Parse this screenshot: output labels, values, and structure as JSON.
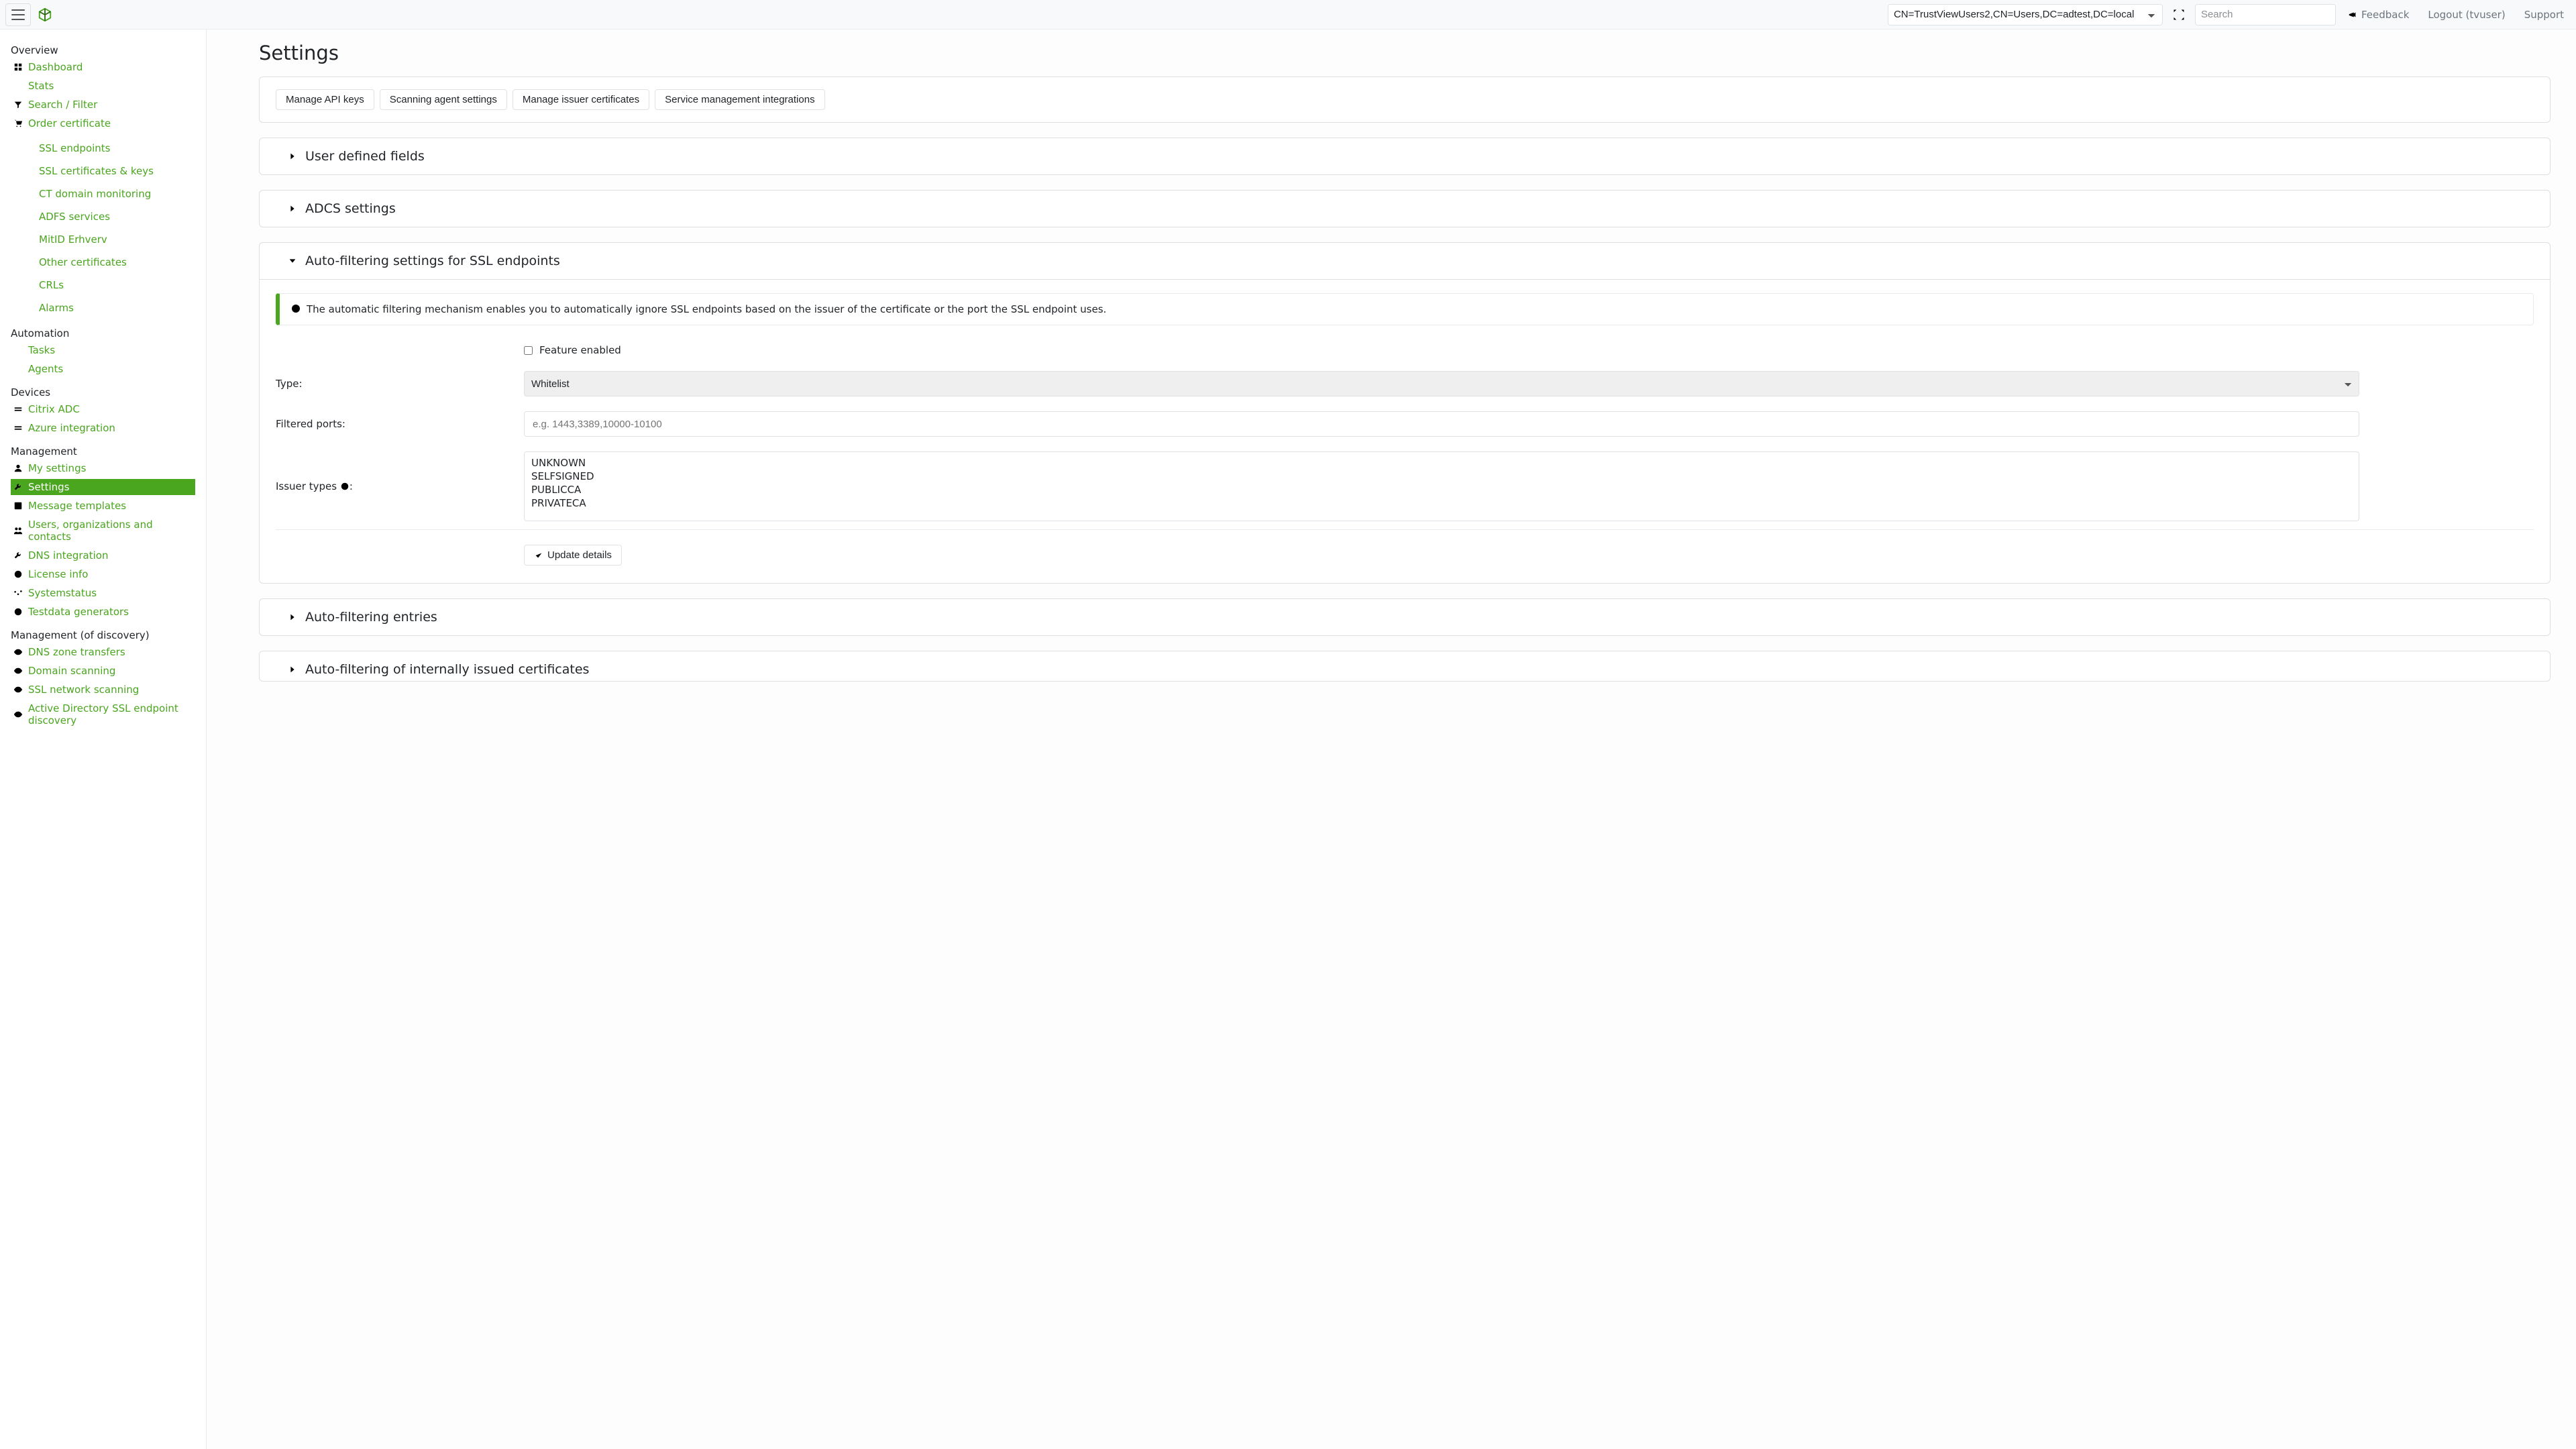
{
  "header": {
    "org_selected": "CN=TrustViewUsers2,CN=Users,DC=adtest,DC=local",
    "search_placeholder": "Search",
    "feedback": "Feedback",
    "logout": "Logout (tvuser)",
    "support": "Support"
  },
  "sidebar": {
    "groups": [
      {
        "title": "Overview",
        "items": [
          {
            "label": "Dashboard",
            "icon": "dashboard-icon"
          },
          {
            "label": "Stats",
            "icon": "list-icon"
          },
          {
            "label": "Search / Filter",
            "icon": "filter-icon"
          },
          {
            "label": "Order certificate",
            "icon": "cart-icon"
          }
        ],
        "secondary": [
          {
            "label": "SSL endpoints",
            "icon": "list-icon"
          },
          {
            "label": "SSL certificates & keys",
            "icon": "list-icon"
          },
          {
            "label": "CT domain monitoring",
            "icon": "list-icon"
          },
          {
            "label": "ADFS services",
            "icon": "list-icon"
          },
          {
            "label": "MitID Erhverv",
            "icon": "list-icon"
          },
          {
            "label": "Other certificates",
            "icon": "list-icon"
          },
          {
            "label": "CRLs",
            "icon": "list-icon"
          },
          {
            "label": "Alarms",
            "icon": "list-icon"
          }
        ]
      },
      {
        "title": "Automation",
        "items": [
          {
            "label": "Tasks",
            "icon": "list-icon"
          },
          {
            "label": "Agents",
            "icon": "list-icon"
          }
        ]
      },
      {
        "title": "Devices",
        "items": [
          {
            "label": "Citrix ADC",
            "icon": "stack-icon"
          },
          {
            "label": "Azure integration",
            "icon": "stack-icon"
          }
        ]
      },
      {
        "title": "Management",
        "items": [
          {
            "label": "My settings",
            "icon": "user-icon"
          },
          {
            "label": "Settings",
            "icon": "wrench-icon",
            "active": true
          },
          {
            "label": "Message templates",
            "icon": "template-icon"
          },
          {
            "label": "Users, organizations and contacts",
            "icon": "users-icon"
          },
          {
            "label": "DNS integration",
            "icon": "wrench-icon"
          },
          {
            "label": "License info",
            "icon": "info-icon"
          },
          {
            "label": "Systemstatus",
            "icon": "sliders-icon"
          },
          {
            "label": "Testdata generators",
            "icon": "globe-icon"
          }
        ]
      },
      {
        "title": "Management (of discovery)",
        "items": [
          {
            "label": "DNS zone transfers",
            "icon": "eye-icon"
          },
          {
            "label": "Domain scanning",
            "icon": "eye-icon"
          },
          {
            "label": "SSL network scanning",
            "icon": "eye-icon"
          },
          {
            "label": "Active Directory SSL endpoint discovery",
            "icon": "eye-icon"
          }
        ]
      }
    ]
  },
  "page": {
    "title": "Settings",
    "action_buttons": [
      "Manage API keys",
      "Scanning agent settings",
      "Manage issuer certificates",
      "Service management integrations"
    ],
    "accordions": {
      "user_defined_fields": "User defined fields",
      "adcs_settings": "ADCS settings",
      "auto_filter_ssl": "Auto-filtering settings for SSL endpoints",
      "auto_filter_entries": "Auto-filtering entries",
      "auto_filter_internal": "Auto-filtering of internally issued certificates"
    },
    "auto_filter": {
      "info": "The automatic filtering mechanism enables you to automatically ignore SSL endpoints based on the issuer of the certificate or the port the SSL endpoint uses.",
      "feature_enabled_label": "Feature enabled",
      "feature_enabled": false,
      "type_label": "Type:",
      "type_value": "Whitelist",
      "filtered_ports_label": "Filtered ports:",
      "filtered_ports_placeholder": "e.g. 1443,3389,10000-10100",
      "filtered_ports_value": "",
      "issuer_types_label": "Issuer types",
      "issuer_types_suffix": ":",
      "issuer_types_options": [
        "UNKNOWN",
        "SELFSIGNED",
        "PUBLICCA",
        "PRIVATECA"
      ],
      "update_label": "Update details"
    }
  }
}
